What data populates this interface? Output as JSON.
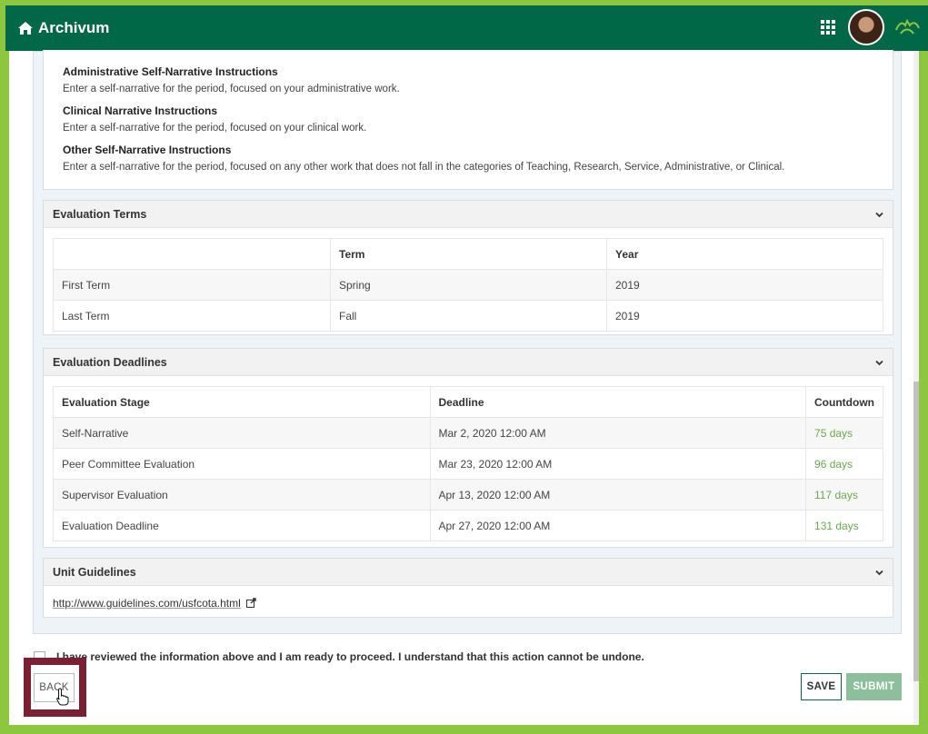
{
  "app": {
    "title": "Archivum"
  },
  "icons": {
    "home": "home-icon",
    "apps": "grid-icon",
    "brand": "bull-logo-icon"
  },
  "colors": {
    "header": "#006747",
    "accent": "#8dc63f",
    "countdown": "#6aa84f",
    "highlight": "#7b1f33"
  },
  "instructions": [
    {
      "title": "Administrative Self-Narrative Instructions",
      "text": "Enter a self-narrative for the period, focused on your administrative work."
    },
    {
      "title": "Clinical Narrative Instructions",
      "text": "Enter a self-narrative for the period, focused on your clinical work."
    },
    {
      "title": "Other Self-Narrative Instructions",
      "text": "Enter a self-narrative for the period, focused on any other work that does not fall in the categories of Teaching, Research, Service, Administrative, or Clinical."
    }
  ],
  "terms": {
    "title": "Evaluation Terms",
    "headers": [
      "",
      "Term",
      "Year"
    ],
    "rows": [
      [
        "First Term",
        "Spring",
        "2019"
      ],
      [
        "Last Term",
        "Fall",
        "2019"
      ]
    ]
  },
  "deadlines": {
    "title": "Evaluation Deadlines",
    "headers": [
      "Evaluation Stage",
      "Deadline",
      "Countdown"
    ],
    "rows": [
      [
        "Self-Narrative",
        "Mar 2, 2020 12:00 AM",
        "75 days"
      ],
      [
        "Peer Committee Evaluation",
        "Mar 23, 2020 12:00 AM",
        "96 days"
      ],
      [
        "Supervisor Evaluation",
        "Apr 13, 2020 12:00 AM",
        "117 days"
      ],
      [
        "Evaluation Deadline",
        "Apr 27, 2020 12:00 AM",
        "131 days"
      ]
    ]
  },
  "guidelines": {
    "title": "Unit Guidelines",
    "link": "http://www.guidelines.com/usfcota.html"
  },
  "confirm": {
    "text": "I have reviewed the information above and I am ready to proceed. I understand that this action cannot be undone."
  },
  "buttons": {
    "back": "BACK",
    "save": "SAVE",
    "submit": "SUBMIT"
  }
}
